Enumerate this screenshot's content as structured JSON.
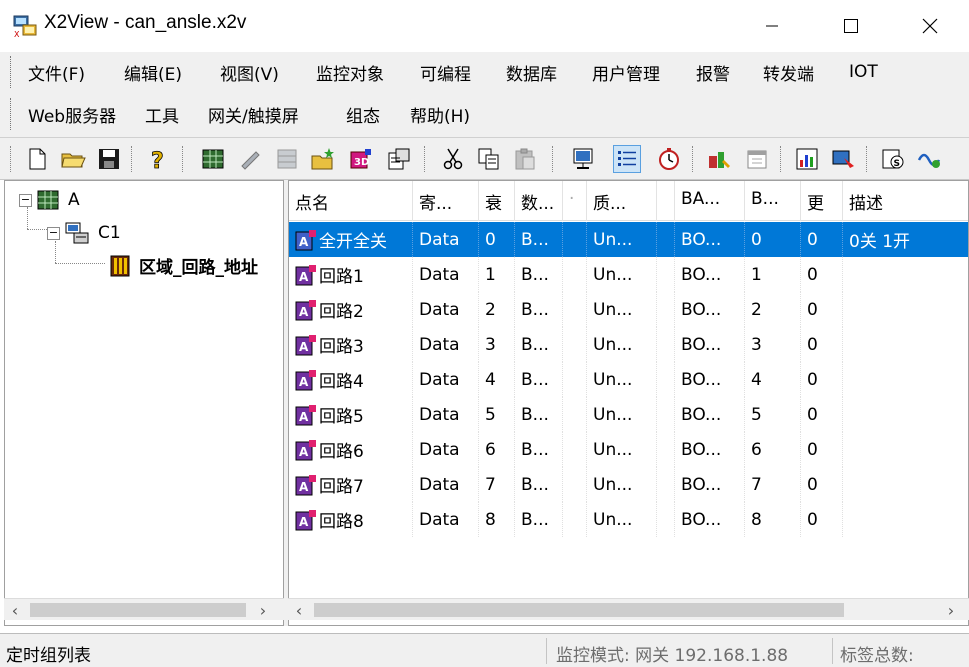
{
  "window": {
    "title": "X2View - can_ansle.x2v"
  },
  "menu": {
    "row1": [
      "文件(F)",
      "编辑(E)",
      "视图(V)",
      "监控对象",
      "可编程",
      "数据库",
      "用户管理",
      "报警",
      "转发端",
      "IOT"
    ],
    "row2": [
      "Web服务器",
      "工具",
      "网关/触摸屏",
      "组态",
      "帮助(H)"
    ]
  },
  "toolbar": {
    "icons": [
      "new-file-icon",
      "open-folder-icon",
      "save-icon",
      "help-icon",
      "grid-icon",
      "pencil-icon",
      "table-icon",
      "folder-star-icon",
      "3d-cube-icon",
      "properties-icon",
      "cut-icon",
      "copy-icon",
      "paste-icon",
      "monitor-icon",
      "list-view-icon",
      "timer-icon",
      "tools-icon",
      "calendar-icon",
      "chart-icon",
      "remote-icon",
      "script-icon",
      "wave-icon"
    ]
  },
  "tree": {
    "root": "A",
    "child": "C1",
    "leaf": "区域_回路_地址"
  },
  "table": {
    "columns": [
      "点名",
      "寄...",
      "衰",
      "数...",
      "·",
      "质...",
      "",
      "BA...",
      "B...",
      "更",
      "描述"
    ],
    "rows": [
      {
        "name": "全开全关",
        "reg": "Data",
        "idx": "0",
        "type": "B...",
        "q": "Un...",
        "ba": "BO...",
        "b": "0",
        "upd": "0",
        "desc": "0关 1开"
      },
      {
        "name": "回路1",
        "reg": "Data",
        "idx": "1",
        "type": "B...",
        "q": "Un...",
        "ba": "BO...",
        "b": "1",
        "upd": "0",
        "desc": ""
      },
      {
        "name": "回路2",
        "reg": "Data",
        "idx": "2",
        "type": "B...",
        "q": "Un...",
        "ba": "BO...",
        "b": "2",
        "upd": "0",
        "desc": ""
      },
      {
        "name": "回路3",
        "reg": "Data",
        "idx": "3",
        "type": "B...",
        "q": "Un...",
        "ba": "BO...",
        "b": "3",
        "upd": "0",
        "desc": ""
      },
      {
        "name": "回路4",
        "reg": "Data",
        "idx": "4",
        "type": "B...",
        "q": "Un...",
        "ba": "BO...",
        "b": "4",
        "upd": "0",
        "desc": ""
      },
      {
        "name": "回路5",
        "reg": "Data",
        "idx": "5",
        "type": "B...",
        "q": "Un...",
        "ba": "BO...",
        "b": "5",
        "upd": "0",
        "desc": ""
      },
      {
        "name": "回路6",
        "reg": "Data",
        "idx": "6",
        "type": "B...",
        "q": "Un...",
        "ba": "BO...",
        "b": "6",
        "upd": "0",
        "desc": ""
      },
      {
        "name": "回路7",
        "reg": "Data",
        "idx": "7",
        "type": "B...",
        "q": "Un...",
        "ba": "BO...",
        "b": "7",
        "upd": "0",
        "desc": ""
      },
      {
        "name": "回路8",
        "reg": "Data",
        "idx": "8",
        "type": "B...",
        "q": "Un...",
        "ba": "BO...",
        "b": "8",
        "upd": "0",
        "desc": ""
      }
    ]
  },
  "status": {
    "left": "定时组列表",
    "mode": "监控模式: 网关 192.168.1.88",
    "tags": "标签总数:"
  },
  "colors": {
    "selection": "#0078d7",
    "chrome": "#f0f0f0"
  }
}
